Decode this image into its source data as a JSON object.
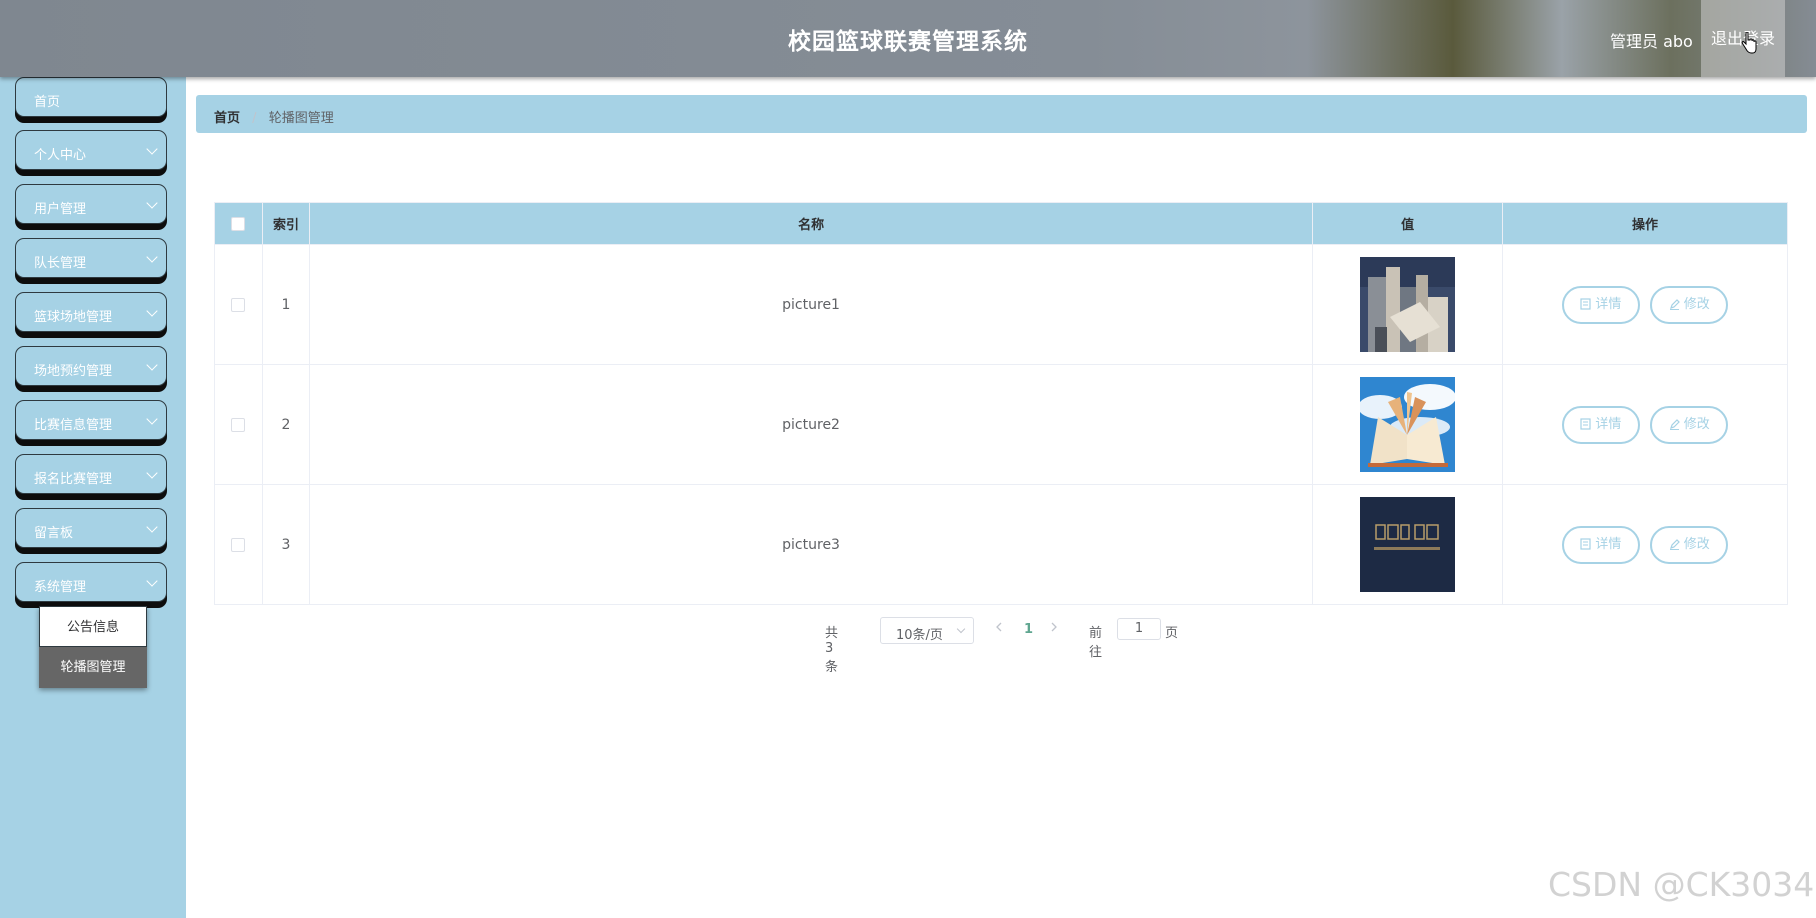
{
  "header": {
    "title": "校园篮球联赛管理系统",
    "admin_label": "管理员 abo",
    "logout_label": "退出登录"
  },
  "sidebar": {
    "items": [
      {
        "label": "首页"
      },
      {
        "label": "个人中心"
      },
      {
        "label": "用户管理"
      },
      {
        "label": "队长管理"
      },
      {
        "label": "篮球场地管理"
      },
      {
        "label": "场地预约管理"
      },
      {
        "label": "比赛信息管理"
      },
      {
        "label": "报名比赛管理"
      },
      {
        "label": "留言板"
      },
      {
        "label": "系统管理"
      }
    ],
    "submenu": [
      {
        "label": "公告信息"
      },
      {
        "label": "轮播图管理"
      }
    ]
  },
  "breadcrumb": {
    "home": "首页",
    "separator": "/",
    "current": "轮播图管理"
  },
  "table": {
    "headers": {
      "index": "索引",
      "name": "名称",
      "value": "值",
      "actions": "操作"
    },
    "rows": [
      {
        "index": "1",
        "name": "picture1",
        "image": "architecture-image"
      },
      {
        "index": "2",
        "name": "picture2",
        "image": "book-sky-image"
      },
      {
        "index": "3",
        "name": "picture3",
        "image": "logo-dark-image"
      }
    ],
    "detail_label": "详情",
    "edit_label": "修改"
  },
  "pagination": {
    "total": "共 3 条",
    "page_size": "10条/页",
    "current_page": "1",
    "goto_label": "前往",
    "goto_value": "1",
    "page_suffix": "页"
  },
  "watermark": "CSDN @CK3034",
  "colors": {
    "accent": "#a6d2e5",
    "active_page": "#5fa690",
    "submenu_active": "#666666"
  }
}
